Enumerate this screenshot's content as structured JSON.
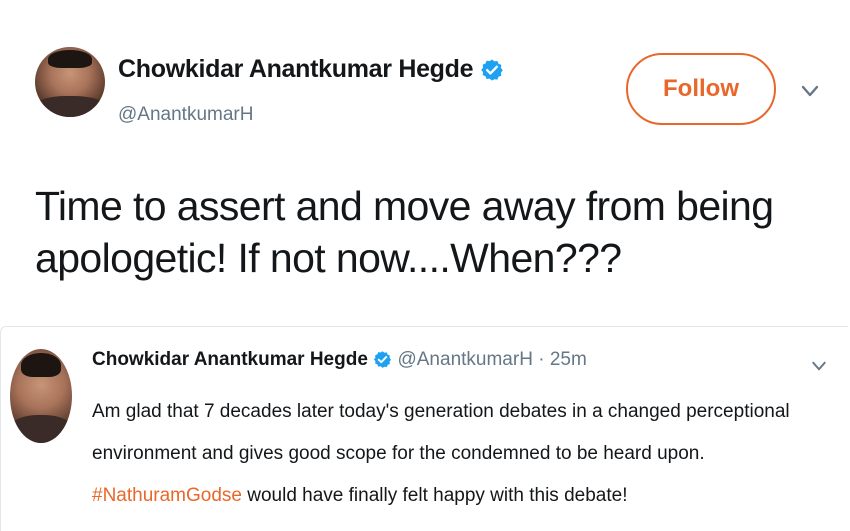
{
  "main_tweet": {
    "author_name": "Chowkidar Anantkumar Hegde",
    "handle": "@AnantkumarH",
    "follow_label": "Follow",
    "text": "Time to assert and move away from being apologetic!  If not now....When???"
  },
  "quoted_tweet": {
    "author_name": "Chowkidar Anantkumar Hegde",
    "handle": "@AnantkumarH",
    "separator": " · ",
    "time": "25m",
    "body_before": "Am glad that 7 decades later today's generation debates in a changed perceptional environment and gives good scope for the  condemned to be heard upon. ",
    "hashtag": "#NathuramGodse",
    "body_after": " would have finally felt happy with this debate!"
  },
  "colors": {
    "accent": "#e9672a",
    "verified": "#1da1f2",
    "muted": "#657786",
    "text": "#14171a"
  },
  "icons": {
    "verified": "verified-badge-icon",
    "more": "chevron-down-icon"
  }
}
